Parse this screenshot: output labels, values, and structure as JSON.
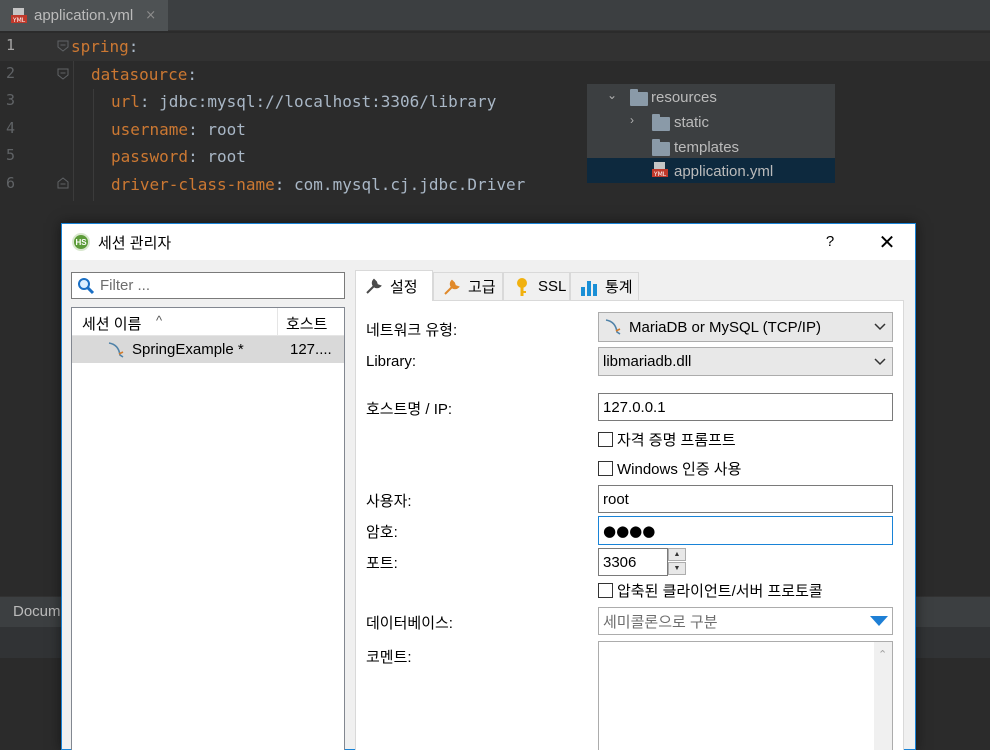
{
  "ide": {
    "tab": {
      "label": "application.yml",
      "icon": "yml-file-icon",
      "close": "×"
    },
    "gutter": [
      "1",
      "2",
      "3",
      "4",
      "5",
      "6"
    ],
    "code": {
      "l1": {
        "key": "spring",
        "sep": ":"
      },
      "l2": {
        "key": "datasource",
        "sep": ":"
      },
      "l3": {
        "key": "url",
        "sep": ": ",
        "value": "jdbc:mysql://localhost:3306/library"
      },
      "l4": {
        "key": "username",
        "sep": ": ",
        "value": "root"
      },
      "l5": {
        "key": "password",
        "sep": ": ",
        "value": "root"
      },
      "l6": {
        "key": "driver-class-name",
        "sep": ": ",
        "value": "com.mysql.cj.jdbc.Driver"
      }
    },
    "project_tree": {
      "resources": "resources",
      "static": "static",
      "templates": "templates",
      "application": "application.yml"
    },
    "bottom_panel_title": "Docum",
    "colors": {
      "key": "#cc7832",
      "value": "#a9b7c6",
      "background": "#2b2b2b",
      "tree_selected": "#0d293e"
    }
  },
  "dialog": {
    "title": "세션 관리자",
    "help": "?",
    "close": "✕",
    "filter_placeholder": "Filter ...",
    "list": {
      "col_name": "세션 이름",
      "sort_indicator": "^",
      "col_host": "호스트",
      "rows": [
        {
          "name": "SpringExample *",
          "host": "127...."
        }
      ]
    },
    "tabs": {
      "settings": "설정",
      "advanced": "고급",
      "ssl": "SSL",
      "stats": "통계"
    },
    "form": {
      "network_type_label": "네트워크 유형:",
      "network_type_value": "MariaDB or MySQL (TCP/IP)",
      "library_label": "Library:",
      "library_value": "libmariadb.dll",
      "host_label": "호스트명 / IP:",
      "host_value": "127.0.0.1",
      "credential_prompt": "자격 증명 프롬프트",
      "windows_auth": "Windows 인증 사용",
      "user_label": "사용자:",
      "user_value": "root",
      "password_label": "암호:",
      "password_value": "●●●●",
      "port_label": "포트:",
      "port_value": "3306",
      "compressed": "압축된 클라이언트/서버 프로토콜",
      "database_label": "데이터베이스:",
      "database_placeholder": "세미콜론으로 구분",
      "comment_label": "코멘트:"
    },
    "colors": {
      "accent": "#1883d7",
      "selected_row": "#d9d9d9"
    }
  }
}
